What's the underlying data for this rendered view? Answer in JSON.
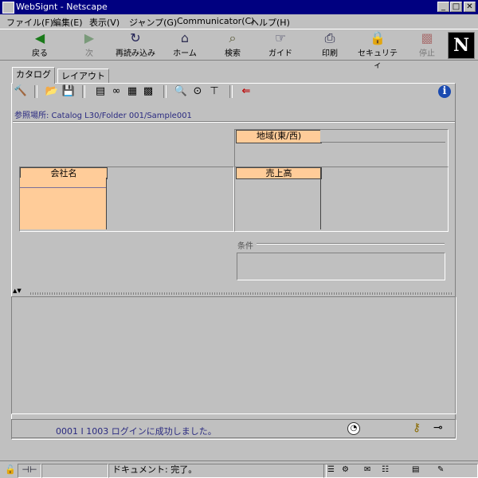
{
  "window": {
    "title": "WebSignt - Netscape",
    "min": "_",
    "max": "□",
    "close": "✕"
  },
  "menu": [
    "ファイル(F)",
    "編集(E)",
    "表示(V)",
    "ジャンプ(G)",
    "Communicator(C)",
    "ヘルプ(H)"
  ],
  "nav": [
    {
      "label": "戻る",
      "icon": "back-arrow-icon",
      "glyph": "◀"
    },
    {
      "label": "次",
      "icon": "forward-arrow-icon",
      "glyph": "▶"
    },
    {
      "label": "再読み込み",
      "icon": "reload-icon",
      "glyph": "↻"
    },
    {
      "label": "ホーム",
      "icon": "home-icon",
      "glyph": "⌂"
    },
    {
      "label": "検索",
      "icon": "search-icon",
      "glyph": "⌕"
    },
    {
      "label": "ガイド",
      "icon": "guide-icon",
      "glyph": "☞"
    },
    {
      "label": "印刷",
      "icon": "print-icon",
      "glyph": "⎙"
    },
    {
      "label": "セキュリティ",
      "icon": "security-lock-icon",
      "glyph": "🔒"
    },
    {
      "label": "停止",
      "icon": "stop-icon",
      "glyph": "▩"
    }
  ],
  "logo": "N",
  "tabs": {
    "catalog": "カタログ",
    "layout": "レイアウト"
  },
  "toolbar": {
    "hammer": "🔨",
    "open_folder": "📂",
    "save": "💾",
    "report": "▤",
    "binoculars": "∞",
    "grid": "▦",
    "chart_grid": "▩",
    "zoom": "🔍",
    "drill": "⊙",
    "pin": "⊤",
    "move_back": "⇐",
    "info": "i"
  },
  "reference_path": "参照場所: Catalog L30/Folder 001/Sample001",
  "pivot": {
    "region_header": "地域(東/西)",
    "company_header": "会社名",
    "sales_header": "売上高",
    "condition_label": "条件"
  },
  "splitter_arrows": "▲▼",
  "status": {
    "login_message": "0001 I 1003 ログインに成功しました。",
    "gauge_icon": "◔",
    "key_icon": "⚷",
    "plug_icon": "⊸"
  },
  "window_status": {
    "security_icon": "🔓",
    "connection_icon": "⊣⊢",
    "document_text": "ドキュメント: 完了。"
  },
  "colors": {
    "title_bar": "#000080",
    "header_fill": "#ffcc99",
    "link_text": "#2a2a80"
  }
}
